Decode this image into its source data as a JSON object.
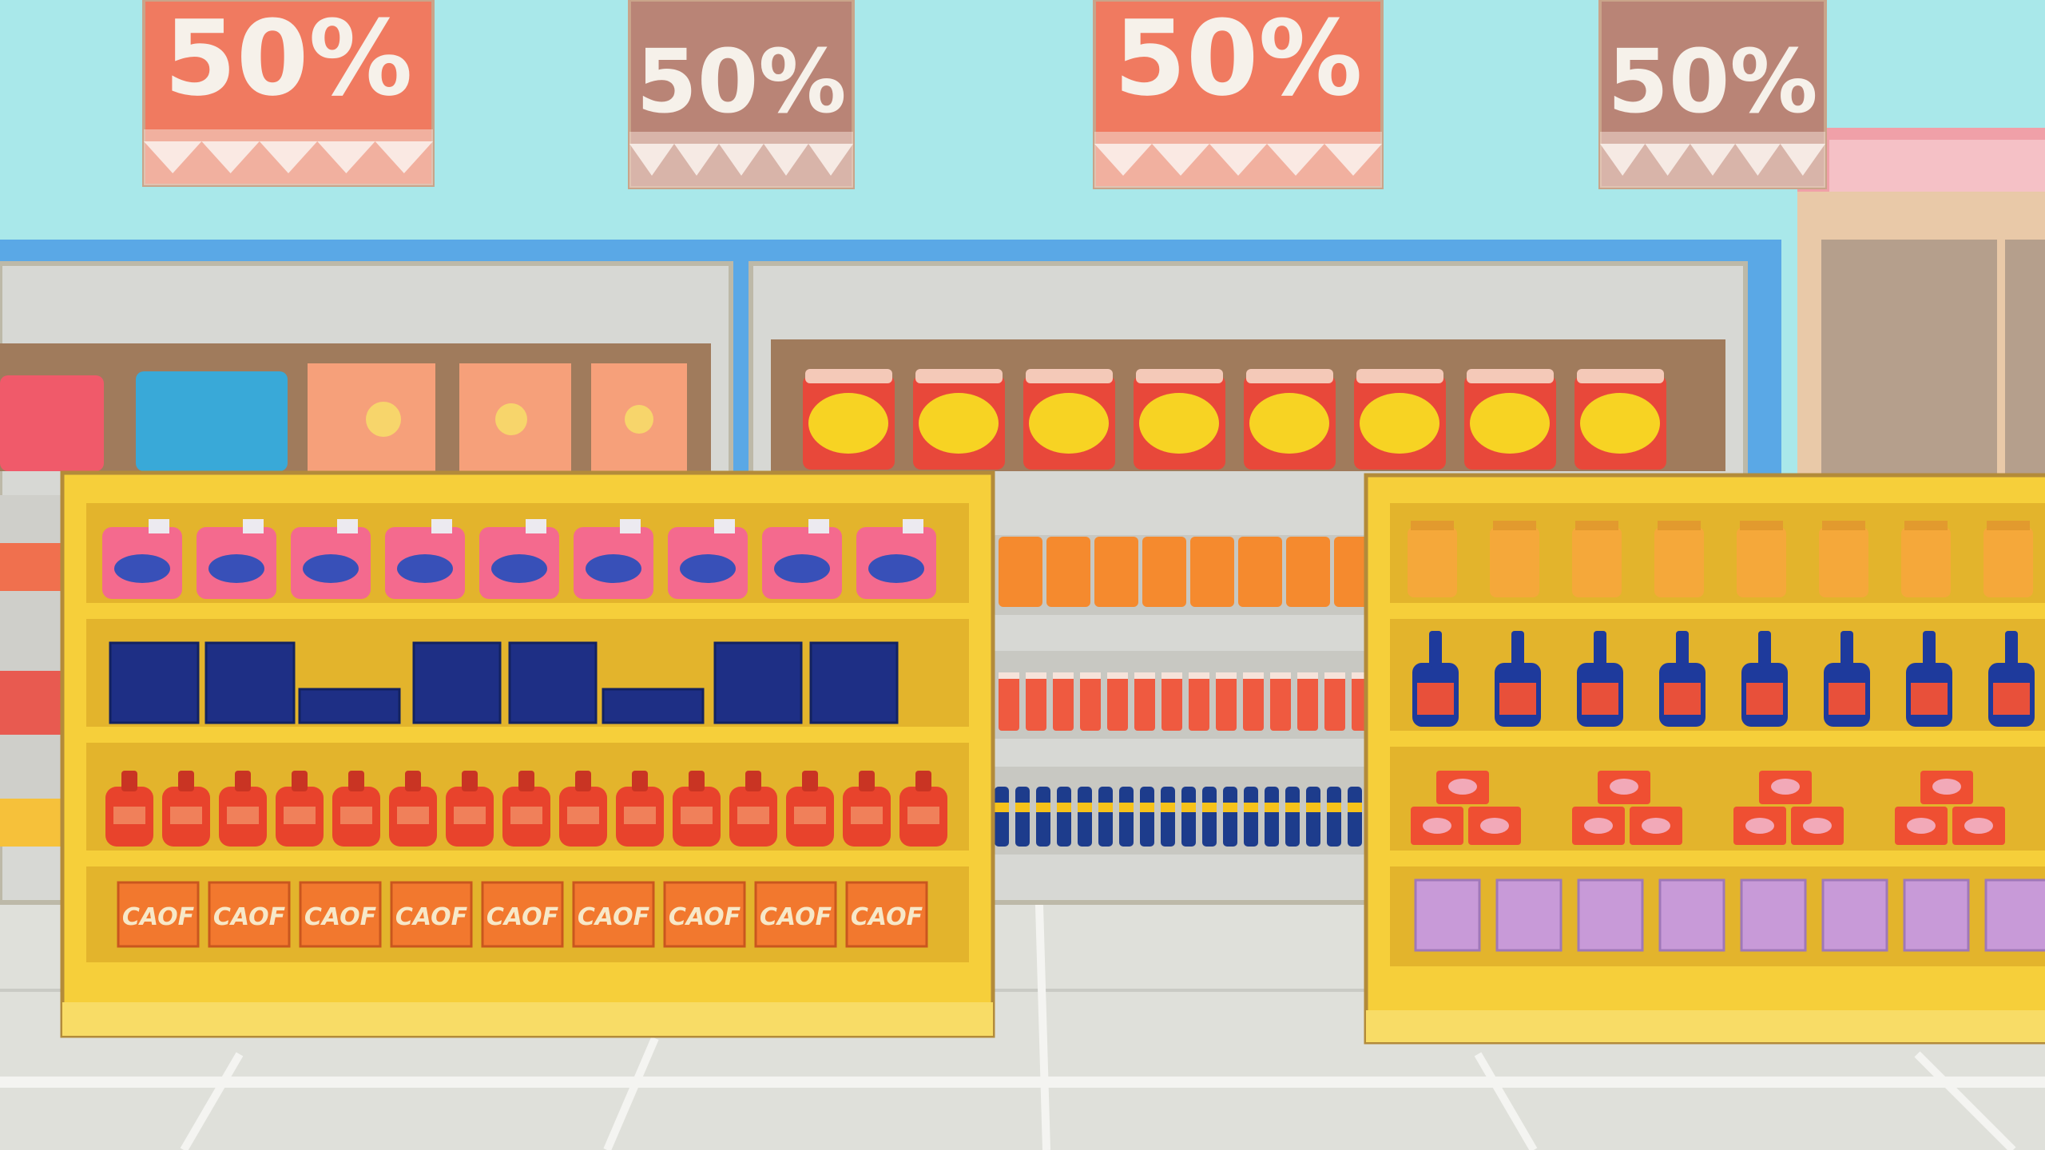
{
  "scene": {
    "description_colors": {
      "wall": "#a9e8ea",
      "floor": "#dfe0da",
      "shelf_yellow": "#f6cf3a",
      "shelf_yellow_dark": "#e3b42c",
      "back_shelf": "#d7d8d4",
      "sign_bright": "#f07a60",
      "sign_muted": "#b98476"
    }
  },
  "signs": [
    {
      "label": "50%",
      "style": "bright"
    },
    {
      "label": "50%",
      "style": "muted"
    },
    {
      "label": "50%",
      "style": "bright"
    },
    {
      "label": "50%",
      "style": "muted"
    }
  ],
  "product_labels": {
    "box_brand": "CAOF"
  }
}
